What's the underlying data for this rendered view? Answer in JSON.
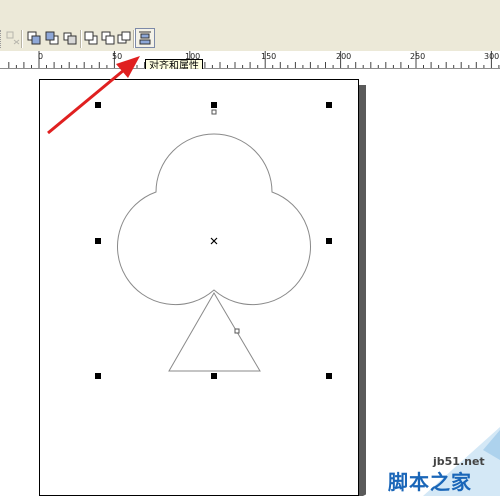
{
  "tooltip": {
    "text": "对齐和属性"
  },
  "ruler": {
    "labels": [
      "0",
      "50",
      "100",
      "150",
      "200",
      "250",
      "300"
    ]
  },
  "toolbar": {
    "buttons": [
      {
        "name": "disabled-tool-icon",
        "disabled": true
      },
      {
        "name": "to-front-icon"
      },
      {
        "name": "to-back-icon"
      },
      {
        "name": "forward-one-icon"
      },
      {
        "name": "back-one-icon"
      },
      {
        "name": "in-front-of-icon"
      },
      {
        "name": "behind-icon"
      },
      {
        "name": "align-distribute-icon",
        "pressed": true
      }
    ]
  },
  "watermark": {
    "site": "jb51.net",
    "name": "脚本之家"
  },
  "colors": {
    "selection": "#000000",
    "shape_stroke": "#8a8a8a",
    "arrow": "#e02020",
    "watermark_brand": "#1a66b8"
  }
}
